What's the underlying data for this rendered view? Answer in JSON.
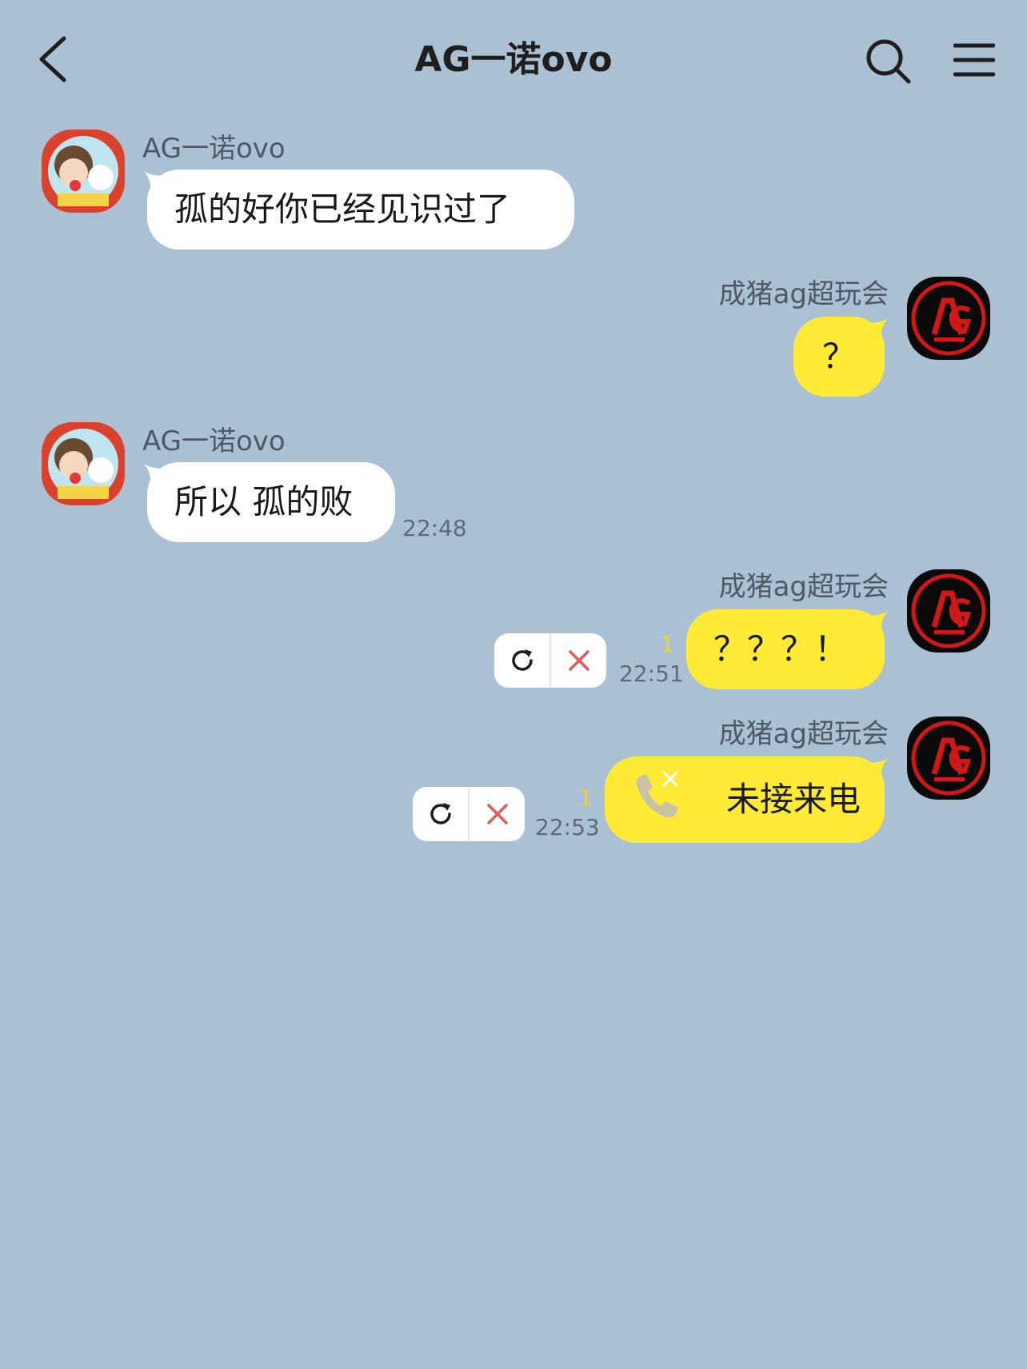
{
  "header": {
    "title": "AG一诺ovo",
    "back_icon": "chevron-left-icon",
    "search_icon": "search-icon",
    "menu_icon": "hamburger-menu-icon"
  },
  "contact": {
    "name": "AG一诺ovo"
  },
  "me": {
    "name": "成猪ag超玩会"
  },
  "messages": [
    {
      "from": "contact",
      "sender": "AG一诺ovo",
      "text": "孤的好你已经见识过了",
      "time": ""
    },
    {
      "from": "me",
      "sender": "成猪ag超玩会",
      "text": "？",
      "time": ""
    },
    {
      "from": "contact",
      "sender": "AG一诺ovo",
      "text": "所以 孤的败",
      "time": "22:48"
    },
    {
      "from": "me",
      "sender": "成猪ag超玩会",
      "text": "？？？！",
      "time": "22:51",
      "unread": "1",
      "failed": true
    },
    {
      "from": "me",
      "sender": "成猪ag超玩会",
      "text": "未接来电",
      "time": "22:53",
      "unread": "1",
      "failed": true,
      "type": "missed-call"
    }
  ],
  "colors": {
    "background": "#abc1d3",
    "incoming_bubble": "#ffffff",
    "outgoing_bubble": "#ffeb35",
    "unread_count": "#f1d31e",
    "delete_x": "#e65a5a"
  }
}
